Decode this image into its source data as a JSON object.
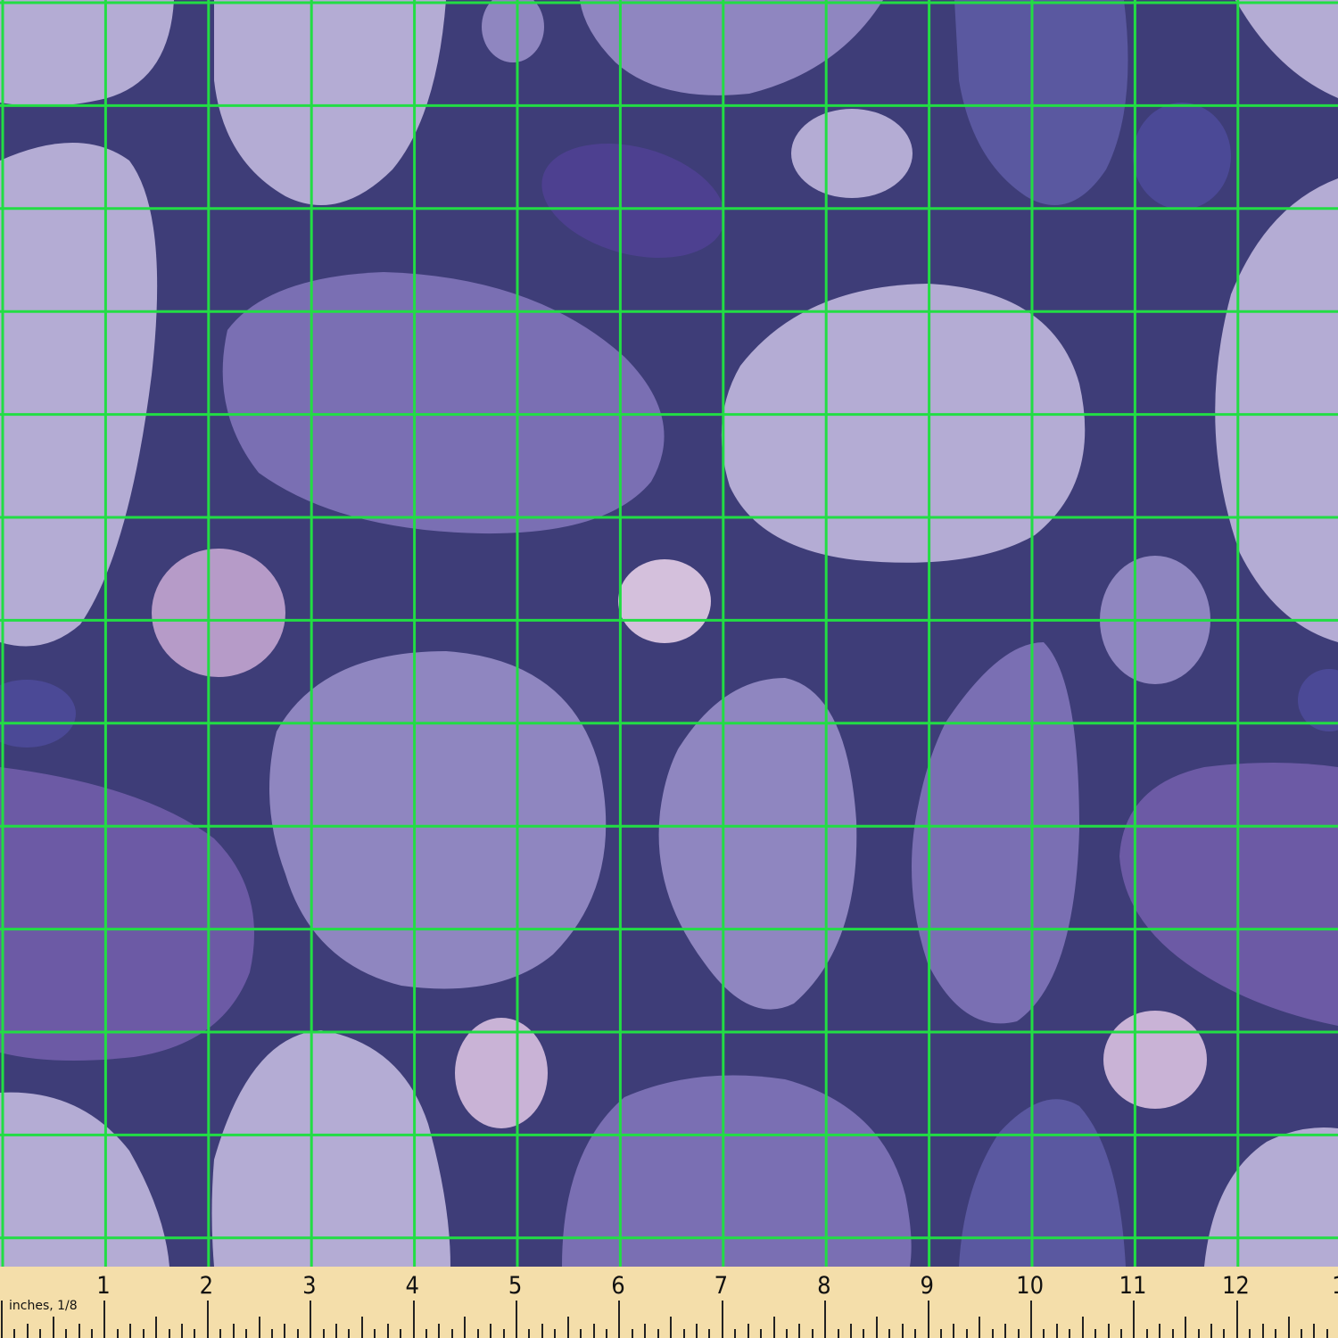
{
  "colors": {
    "background": "#3e3d78",
    "stone_light": "#b4acd4",
    "stone_mid": "#8f86c0",
    "stone_dark": "#7a6fb3",
    "stone_violet": "#6c5aa5",
    "stone_blue": "#5a58a0",
    "stone_pink": "#c9b3d6",
    "grid": "#22dd44",
    "ruler": "#f4deaa"
  },
  "ruler": {
    "unit_label": "inches, 1/8",
    "numbers": [
      "1",
      "2",
      "3",
      "4",
      "5",
      "6",
      "7",
      "8",
      "9",
      "10",
      "11",
      "12",
      "1"
    ]
  }
}
